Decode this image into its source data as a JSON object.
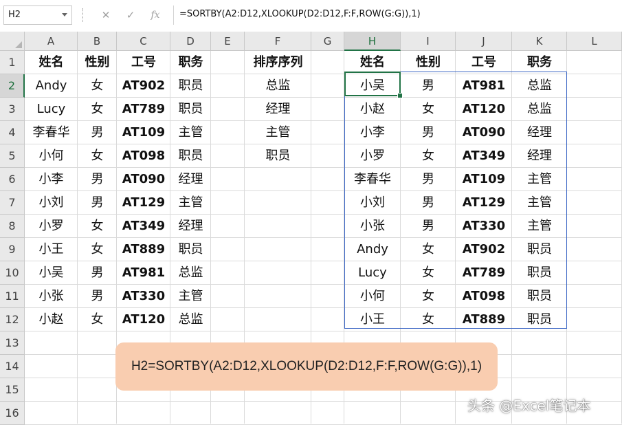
{
  "name_box": {
    "value": "H2"
  },
  "formula_bar": {
    "cancel_glyph": "✕",
    "enter_glyph": "✓",
    "fx_glyph": "fx",
    "formula": "=SORTBY(A2:D12,XLOOKUP(D2:D12,F:F,ROW(G:G)),1)"
  },
  "columns": [
    "A",
    "B",
    "C",
    "D",
    "E",
    "F",
    "G",
    "H",
    "I",
    "J",
    "K",
    "L"
  ],
  "active_column": "H",
  "rows": [
    "1",
    "2",
    "3",
    "4",
    "5",
    "6",
    "7",
    "8",
    "9",
    "10",
    "11",
    "12",
    "13",
    "14",
    "15",
    "16"
  ],
  "active_row": "2",
  "source_table": {
    "headers": [
      "姓名",
      "性别",
      "工号",
      "职务"
    ],
    "rows": [
      [
        "Andy",
        "女",
        "AT902",
        "职员"
      ],
      [
        "Lucy",
        "女",
        "AT789",
        "职员"
      ],
      [
        "李春华",
        "男",
        "AT109",
        "主管"
      ],
      [
        "小何",
        "女",
        "AT098",
        "职员"
      ],
      [
        "小李",
        "男",
        "AT090",
        "经理"
      ],
      [
        "小刘",
        "男",
        "AT129",
        "主管"
      ],
      [
        "小罗",
        "女",
        "AT349",
        "经理"
      ],
      [
        "小王",
        "女",
        "AT889",
        "职员"
      ],
      [
        "小吴",
        "男",
        "AT981",
        "总监"
      ],
      [
        "小张",
        "男",
        "AT330",
        "主管"
      ],
      [
        "小赵",
        "女",
        "AT120",
        "总监"
      ]
    ]
  },
  "sort_order": {
    "header": "排序序列",
    "items": [
      "总监",
      "经理",
      "主管",
      "职员"
    ]
  },
  "result_table": {
    "headers": [
      "姓名",
      "性别",
      "工号",
      "职务"
    ],
    "rows": [
      [
        "小吴",
        "男",
        "AT981",
        "总监"
      ],
      [
        "小赵",
        "女",
        "AT120",
        "总监"
      ],
      [
        "小李",
        "男",
        "AT090",
        "经理"
      ],
      [
        "小罗",
        "女",
        "AT349",
        "经理"
      ],
      [
        "李春华",
        "男",
        "AT109",
        "主管"
      ],
      [
        "小刘",
        "男",
        "AT129",
        "主管"
      ],
      [
        "小张",
        "男",
        "AT330",
        "主管"
      ],
      [
        "Andy",
        "女",
        "AT902",
        "职员"
      ],
      [
        "Lucy",
        "女",
        "AT789",
        "职员"
      ],
      [
        "小何",
        "女",
        "AT098",
        "职员"
      ],
      [
        "小王",
        "女",
        "AT889",
        "职员"
      ]
    ]
  },
  "callout": {
    "text": "H2=SORTBY(A2:D12,XLOOKUP(D2:D12,F:F,ROW(G:G)),1)"
  },
  "watermark": {
    "text": "头条 @Excel笔记本"
  },
  "colors": {
    "selection_green": "#217346",
    "range_blue": "#3a65c4",
    "callout_fill": "#f9cdb0",
    "header_gray": "#e9e9e9"
  }
}
